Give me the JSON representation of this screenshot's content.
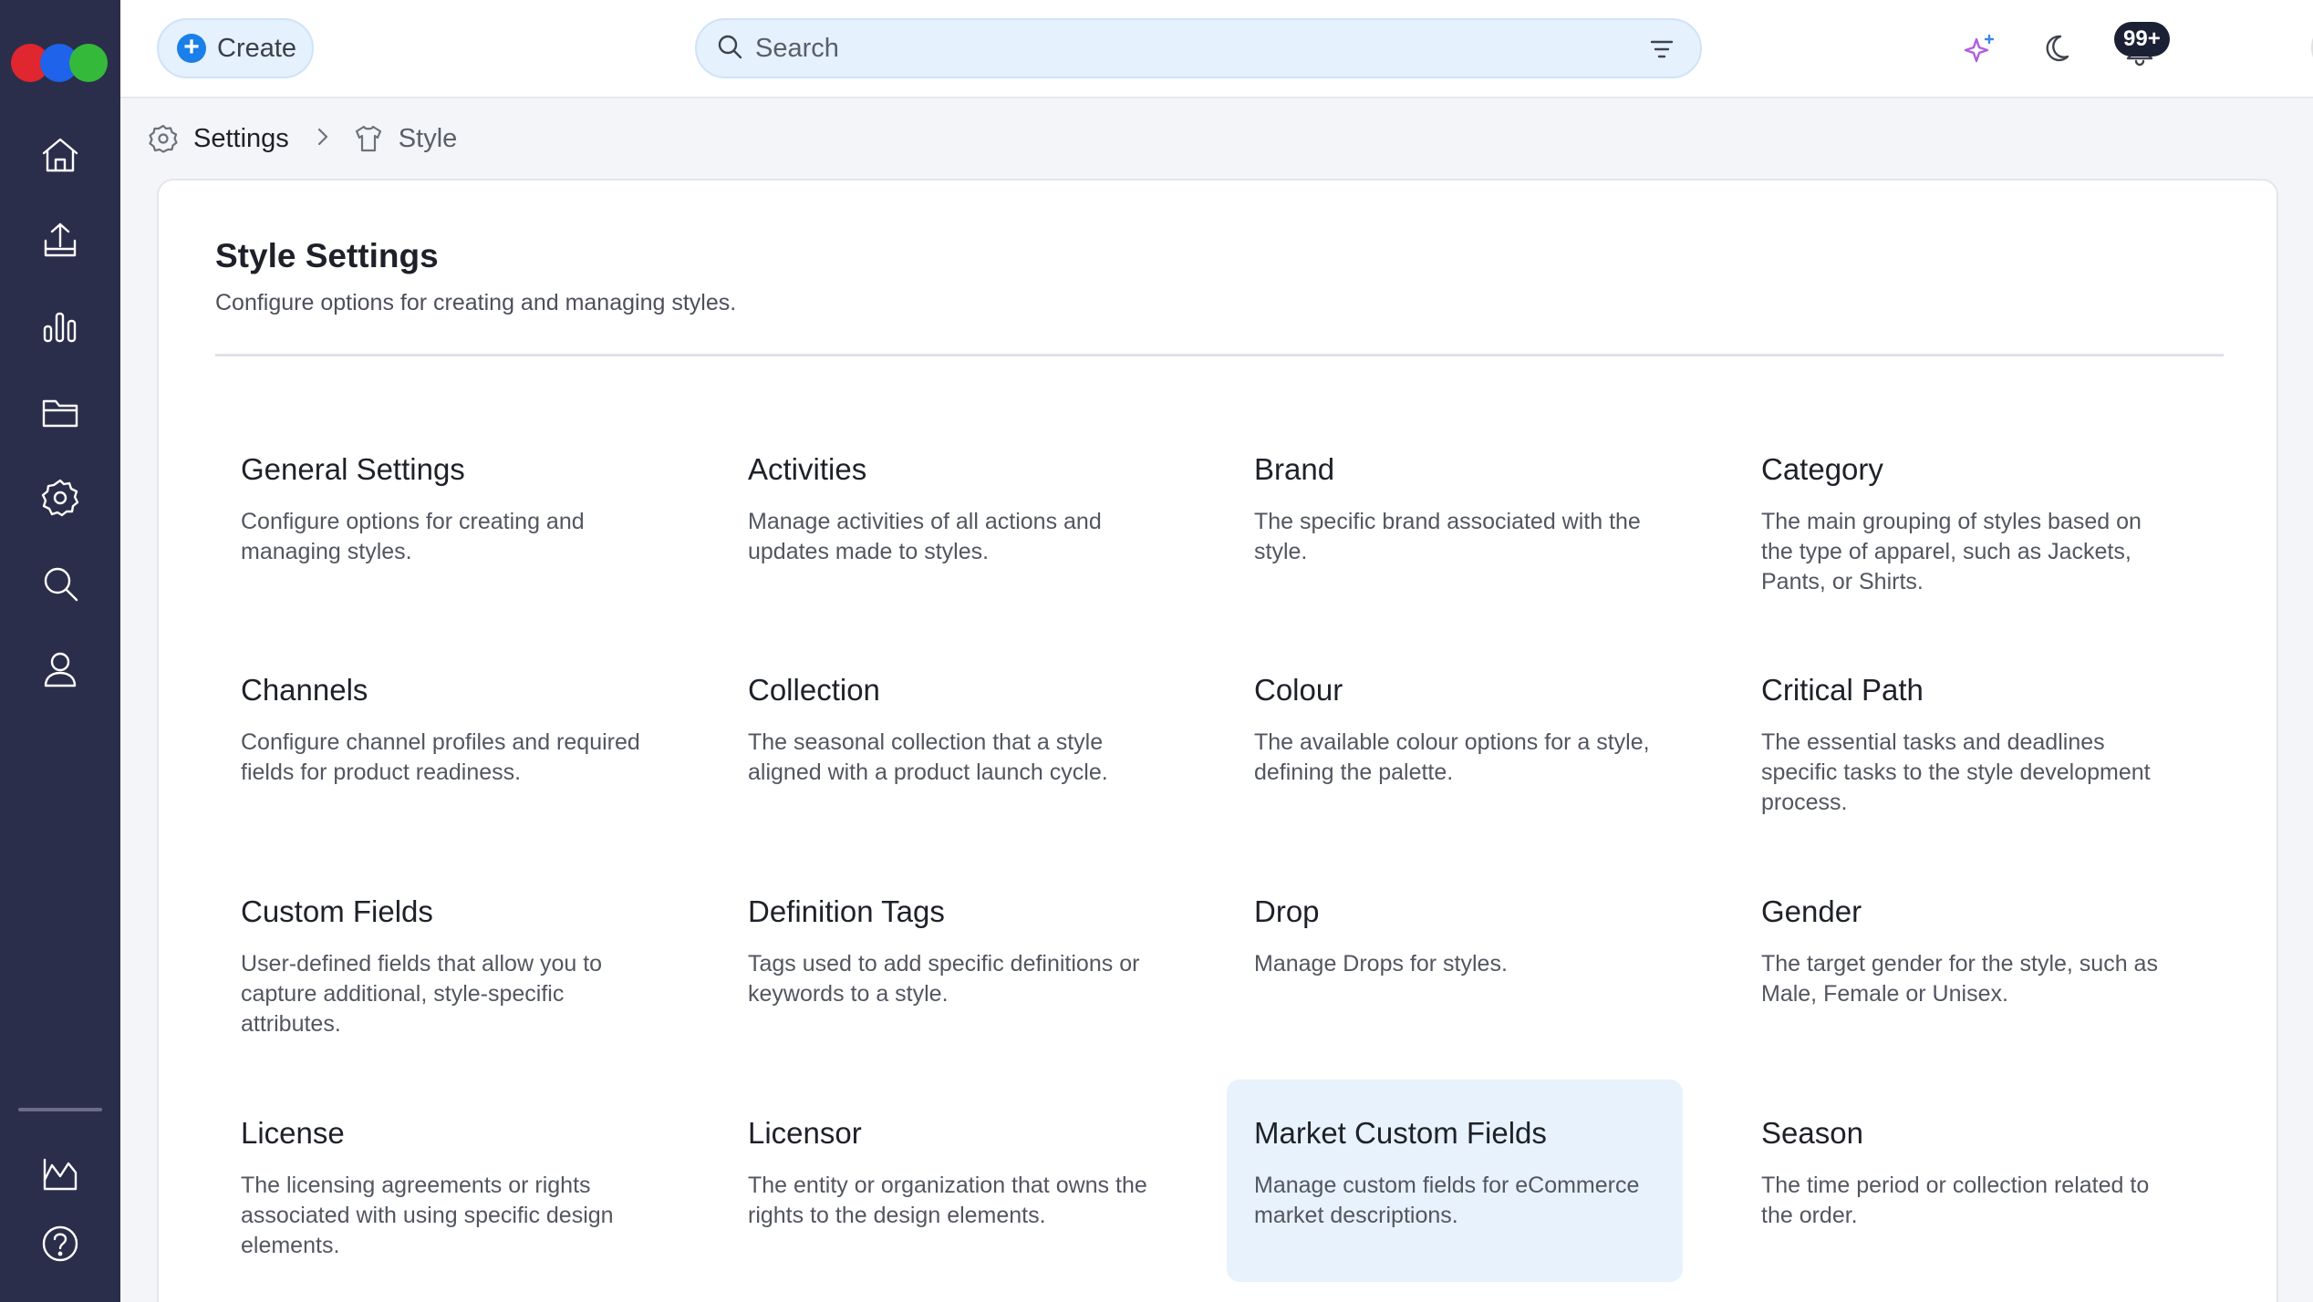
{
  "topbar": {
    "create_label": "Create",
    "search_placeholder": "Search",
    "notification_count": "99+"
  },
  "breadcrumb": {
    "settings": "Settings",
    "current": "Style"
  },
  "page": {
    "title": "Style Settings",
    "subtitle": "Configure options for creating and managing styles."
  },
  "tiles": [
    {
      "title": "General Settings",
      "desc": "Configure options for creating and managing styles."
    },
    {
      "title": "Activities",
      "desc": "Manage activities of all actions and updates made to styles."
    },
    {
      "title": "Brand",
      "desc": "The specific brand associated with the style."
    },
    {
      "title": "Category",
      "desc": "The main grouping of styles based on the type of apparel, such as Jackets, Pants, or Shirts."
    },
    {
      "title": "Channels",
      "desc": "Configure channel profiles and required fields for product readiness."
    },
    {
      "title": "Collection",
      "desc": "The seasonal collection that a style aligned with a product launch cycle."
    },
    {
      "title": "Colour",
      "desc": "The available colour options for a style, defining the palette."
    },
    {
      "title": "Critical Path",
      "desc": "The essential tasks and deadlines specific tasks to the style development process."
    },
    {
      "title": "Custom Fields",
      "desc": "User-defined fields that allow you to capture additional, style-specific attributes."
    },
    {
      "title": "Definition Tags",
      "desc": "Tags used to add specific definitions or keywords to a style."
    },
    {
      "title": "Drop",
      "desc": "Manage Drops for styles."
    },
    {
      "title": "Gender",
      "desc": "The target gender for the style, such as Male, Female or Unisex."
    },
    {
      "title": "License",
      "desc": "The licensing agreements or rights associated with using specific design elements."
    },
    {
      "title": "Licensor",
      "desc": "The entity or organization that owns the rights to the design elements."
    },
    {
      "title": "Market Custom Fields",
      "desc": "Manage custom fields for eCommerce market descriptions."
    },
    {
      "title": "Season",
      "desc": "The time period or collection related to the order."
    }
  ],
  "active_tile": "Market Custom Fields",
  "colors": {
    "sidebar": "#2b2e4a",
    "accent": "#1a7fe8",
    "active_tile_bg": "#e8f2fd"
  },
  "icons": {
    "sidebar": [
      "home-icon",
      "upload-icon",
      "chart-icon",
      "folder-icon",
      "gear-icon",
      "search-icon",
      "user-icon",
      "reports-icon",
      "help-icon"
    ],
    "topbar": [
      "sparkle-icon",
      "moon-icon",
      "bell-icon",
      "chevron-down-icon"
    ]
  }
}
